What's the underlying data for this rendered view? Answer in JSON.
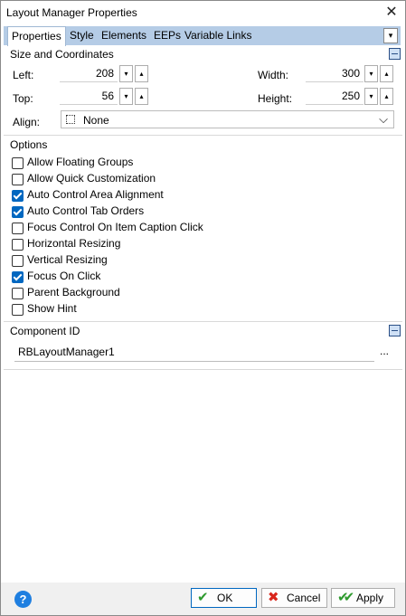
{
  "window": {
    "title": "Layout Manager Properties"
  },
  "tabs": [
    "Properties",
    "Style",
    "Elements",
    "EEPs",
    "Variable Links"
  ],
  "size": {
    "section_label": "Size and Coordinates",
    "left_label": "Left:",
    "left_value": "208",
    "top_label": "Top:",
    "top_value": "56",
    "width_label": "Width:",
    "width_value": "300",
    "height_label": "Height:",
    "height_value": "250",
    "align_label": "Align:",
    "align_value": "None"
  },
  "options": {
    "section_label": "Options",
    "items": [
      {
        "label": "Allow Floating Groups",
        "checked": false
      },
      {
        "label": "Allow Quick Customization",
        "checked": false
      },
      {
        "label": "Auto Control Area Alignment",
        "checked": true
      },
      {
        "label": "Auto Control Tab Orders",
        "checked": true
      },
      {
        "label": "Focus Control On Item Caption Click",
        "checked": false
      },
      {
        "label": "Horizontal Resizing",
        "checked": false
      },
      {
        "label": "Vertical Resizing",
        "checked": false
      },
      {
        "label": "Focus On Click",
        "checked": true
      },
      {
        "label": "Parent Background",
        "checked": false
      },
      {
        "label": "Show Hint",
        "checked": false
      }
    ]
  },
  "component": {
    "section_label": "Component ID",
    "value": "RBLayoutManager1",
    "browse_label": "..."
  },
  "footer": {
    "help_label": "?",
    "ok_label": "OK",
    "cancel_label": "Cancel",
    "apply_label": "Apply"
  },
  "icons": {
    "spin_down": "▾",
    "spin_up": "▴",
    "tab_dropdown": "▾",
    "select_chevron": "⌵",
    "close": "✕"
  },
  "colors": {
    "accent": "#0067c0",
    "tab_bar": "#b5cce6",
    "ok_check": "#2e9a2e",
    "cancel_x": "#d9261c",
    "help": "#1f7fe0"
  }
}
